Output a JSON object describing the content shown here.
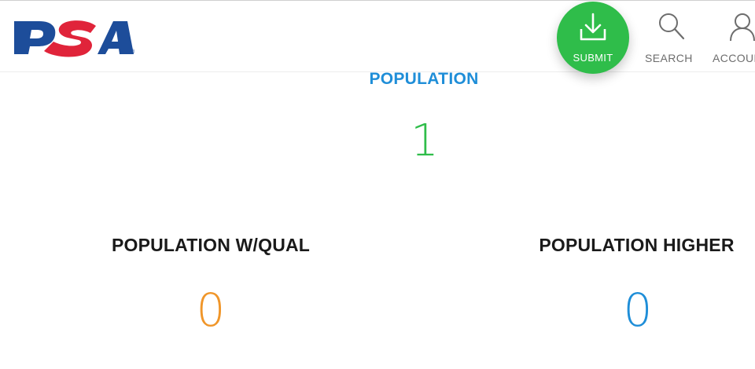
{
  "header": {
    "logo_text": "PSA",
    "logo_reg": "®",
    "submit_label": "SUBMIT",
    "search_label": "SEARCH",
    "account_label": "ACCOUNT"
  },
  "population": {
    "title": "POPULATION",
    "value": "1"
  },
  "stats": {
    "qual_label": "POPULATION W/QUAL",
    "qual_value": "0",
    "higher_label": "POPULATION HIGHER",
    "higher_value": "0"
  },
  "colors": {
    "brand_blue": "#1d4d9a",
    "brand_red": "#e0243a",
    "submit_green": "#2fbd4a",
    "title_blue": "#1f8ed8",
    "qual_orange": "#f0962a",
    "higher_blue": "#1f8ed8"
  },
  "icons": {
    "submit": "download-tray-icon",
    "search": "magnifier-icon",
    "account": "user-icon"
  }
}
